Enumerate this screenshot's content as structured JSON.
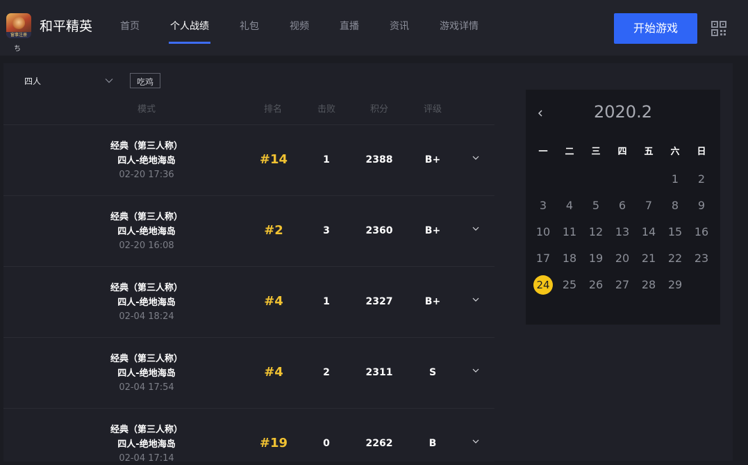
{
  "app": {
    "title": "和平精英",
    "logo_text": "窗事注册"
  },
  "nav": [
    "首页",
    "个人战绩",
    "礼包",
    "视频",
    "直播",
    "资讯",
    "游戏详情"
  ],
  "nav_active_index": 1,
  "header": {
    "start_button": "开始游戏",
    "partial_mark": "ち"
  },
  "filters": {
    "mode_select": "四人",
    "tag": "吃鸡"
  },
  "table": {
    "headers": [
      "模式",
      "排名",
      "击败",
      "积分",
      "评级"
    ],
    "rows": [
      {
        "mode": "经典（第三人称）",
        "map": "四人-绝地海岛",
        "time": "02-20 17:36",
        "rank": "#14",
        "kills": "1",
        "score": "2388",
        "grade": "B+"
      },
      {
        "mode": "经典（第三人称）",
        "map": "四人-绝地海岛",
        "time": "02-20 16:08",
        "rank": "#2",
        "kills": "3",
        "score": "2360",
        "grade": "B+"
      },
      {
        "mode": "经典（第三人称）",
        "map": "四人-绝地海岛",
        "time": "02-04 18:24",
        "rank": "#4",
        "kills": "1",
        "score": "2327",
        "grade": "B+"
      },
      {
        "mode": "经典（第三人称）",
        "map": "四人-绝地海岛",
        "time": "02-04 17:54",
        "rank": "#4",
        "kills": "2",
        "score": "2311",
        "grade": "S"
      },
      {
        "mode": "经典（第三人称）",
        "map": "四人-绝地海岛",
        "time": "02-04 17:14",
        "rank": "#19",
        "kills": "0",
        "score": "2262",
        "grade": "B"
      }
    ]
  },
  "calendar": {
    "title": "2020.2",
    "weekdays": [
      "一",
      "二",
      "三",
      "四",
      "五",
      "六",
      "日"
    ],
    "weeks": [
      [
        "",
        "",
        "",
        "",
        "",
        "1",
        "2"
      ],
      [
        "3",
        "4",
        "5",
        "6",
        "7",
        "8",
        "9"
      ],
      [
        "10",
        "11",
        "12",
        "13",
        "14",
        "15",
        "16"
      ],
      [
        "17",
        "18",
        "19",
        "20",
        "21",
        "22",
        "23"
      ],
      [
        "24",
        "25",
        "26",
        "27",
        "28",
        "29",
        ""
      ]
    ],
    "selected": "24"
  },
  "colors": {
    "accent": "#3e6df5",
    "button": "#2f65f6",
    "rank": "#f1c232",
    "selected_day": "#f5c518"
  },
  "icons": {
    "mode_select": "chevron-down-icon",
    "expand": "chevron-down-icon",
    "calendar_prev": "chevron-left-icon",
    "qr": "qr-code-icon"
  }
}
